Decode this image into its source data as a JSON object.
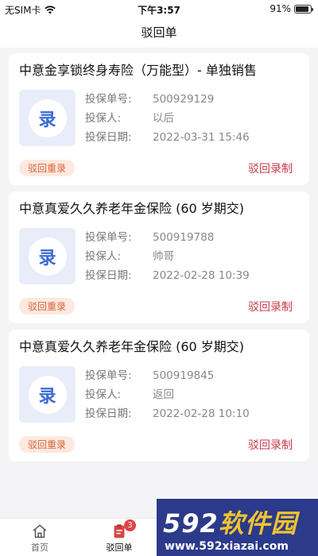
{
  "status_bar": {
    "carrier": "无SIM卡",
    "time": "下午3:57",
    "battery_percent": "91%",
    "battery_level": 0.91
  },
  "nav": {
    "title": "驳回单"
  },
  "cards": [
    {
      "title": "中意金享锁终身寿险（万能型）- 单独销售",
      "icon_char": "录",
      "policy_no_label": "投保单号:",
      "policy_no": "500929129",
      "holder_label": "投保人:",
      "holder": "以后",
      "date_label": "投保日期:",
      "date": "2022-03-31 15:46",
      "badge": "驳回重录",
      "action": "驳回录制"
    },
    {
      "title": "中意真爱久久养老年金保险 (60 岁期交)",
      "icon_char": "录",
      "policy_no_label": "投保单号:",
      "policy_no": "500919788",
      "holder_label": "投保人:",
      "holder": "帅哥",
      "date_label": "投保日期:",
      "date": "2022-02-28 10:39",
      "badge": "驳回重录",
      "action": "驳回录制"
    },
    {
      "title": "中意真爱久久养老年金保险 (60 岁期交)",
      "icon_char": "录",
      "policy_no_label": "投保单号:",
      "policy_no": "500919845",
      "holder_label": "投保人:",
      "holder": "返回",
      "date_label": "投保日期:",
      "date": "2022-02-28 10:10",
      "badge": "驳回重录",
      "action": "驳回录制"
    }
  ],
  "tab_bar": {
    "home_label": "首页",
    "reject_label": "驳回单",
    "reject_badge": "3"
  },
  "watermark": {
    "brand_num": "592",
    "brand_cn": "软件园",
    "url": "www.592xiazai.com"
  },
  "colors": {
    "accent_red": "#c83a4a",
    "badge_bg": "#fde9df",
    "badge_text": "#d9623a",
    "icon_blue": "#3a6bd4"
  }
}
